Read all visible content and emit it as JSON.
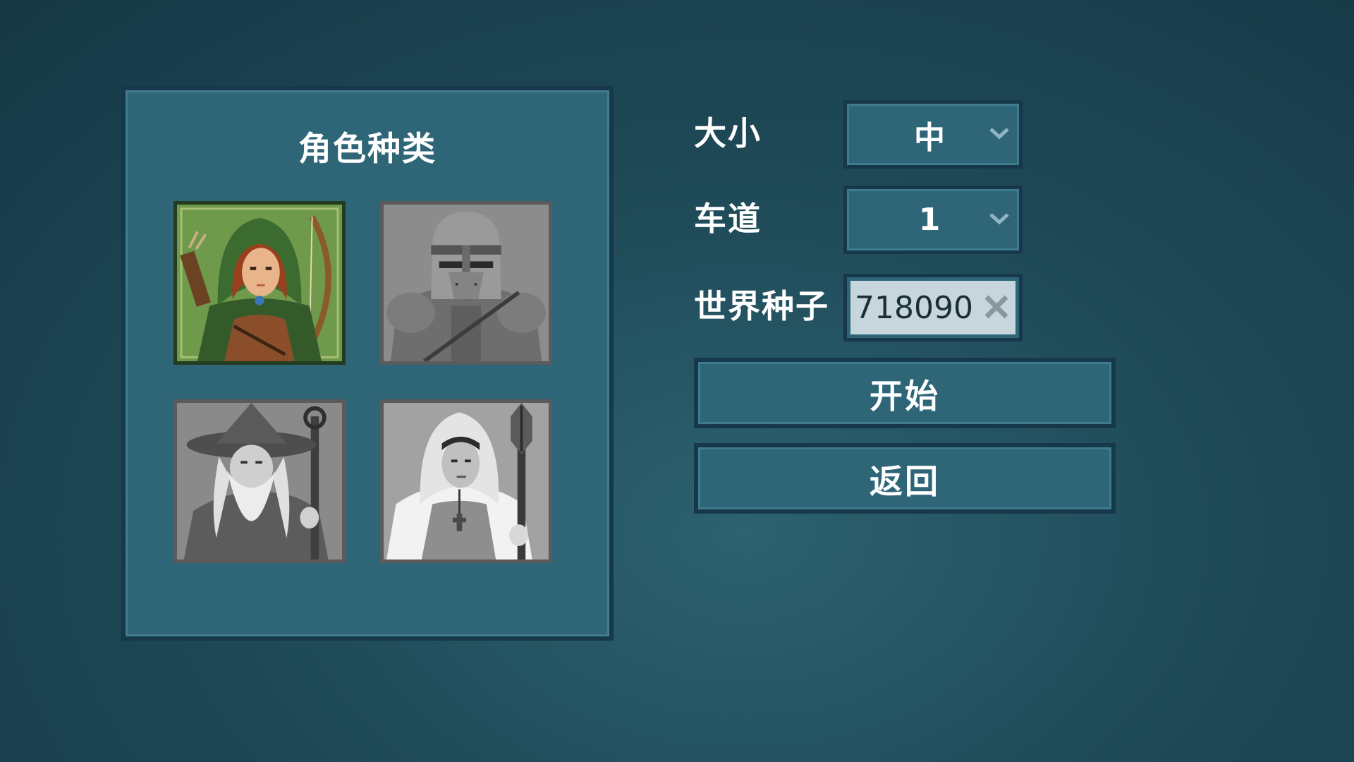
{
  "class_panel": {
    "title": "角色种类",
    "classes": [
      {
        "icon": "archer-portrait-icon",
        "selected": true
      },
      {
        "icon": "knight-portrait-icon",
        "selected": false
      },
      {
        "icon": "wizard-portrait-icon",
        "selected": false
      },
      {
        "icon": "cleric-portrait-icon",
        "selected": false
      }
    ]
  },
  "settings": {
    "size": {
      "label": "大小",
      "value": "中"
    },
    "lanes": {
      "label": "车道",
      "value": "1"
    },
    "seed": {
      "label": "世界种子",
      "value": "718090"
    }
  },
  "buttons": {
    "start_label": "开始",
    "back_label": "返回"
  },
  "colors": {
    "panel": "#2e6678",
    "border": "#17384a",
    "background": "#1f4a58",
    "selected_card": "#4d7d3a",
    "inactive_card": "#8a8a8a",
    "seed_field": "#c6d6dc"
  }
}
